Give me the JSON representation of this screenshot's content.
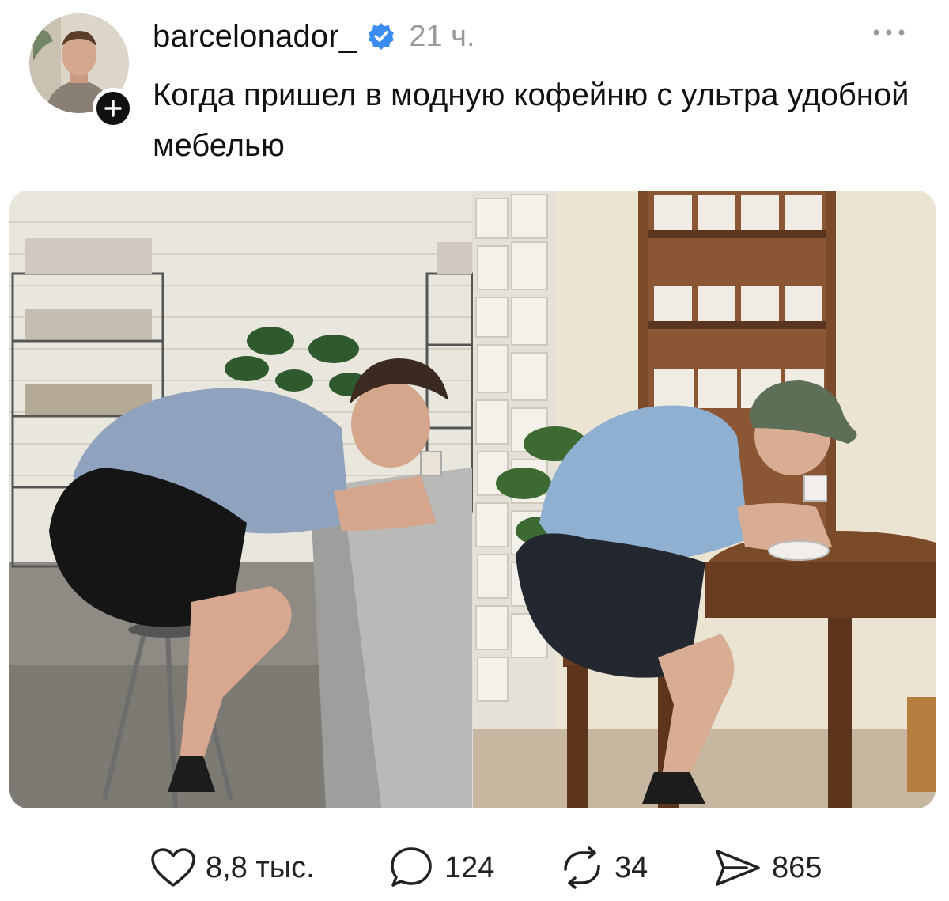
{
  "post": {
    "username": "barcelonador_",
    "time": "21 ч.",
    "text": "Когда пришел в модную кофейню с ультра удобной мебелью"
  },
  "icons": {
    "avatar": "avatar-photo",
    "follow": "plus-icon",
    "verified": "verified-badge-icon",
    "more": "more-dots-icon",
    "like": "heart-icon",
    "comment": "comment-bubble-icon",
    "repost": "repost-icon",
    "share": "send-icon"
  },
  "actions": {
    "likes": "8,8 тыс.",
    "comments": "124",
    "reposts": "34",
    "shares": "865"
  },
  "colors": {
    "verified": "#3b8cf0",
    "text": "#111111",
    "muted": "#9a9a9a"
  }
}
